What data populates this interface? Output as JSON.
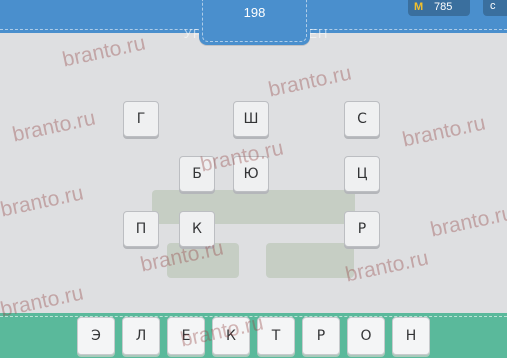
{
  "header": {
    "level": "198",
    "coins": "785",
    "coin_symbol": "M",
    "corner_glyph": "c",
    "title": "УРОВЕНЬ ПРОЙДЕН"
  },
  "letter_grid": [
    "Г",
    "Ш",
    "С",
    "Б",
    "Ю",
    "Ц",
    "П",
    "К",
    "Р"
  ],
  "answer": [
    "Э",
    "Л",
    "Е",
    "К",
    "Т",
    "Р",
    "О",
    "Н"
  ],
  "watermark": "branto.ru",
  "colors": {
    "header_blue": "#4a8fcd",
    "answer_bar_green": "#5ab99b",
    "background": "#dedfe1"
  }
}
